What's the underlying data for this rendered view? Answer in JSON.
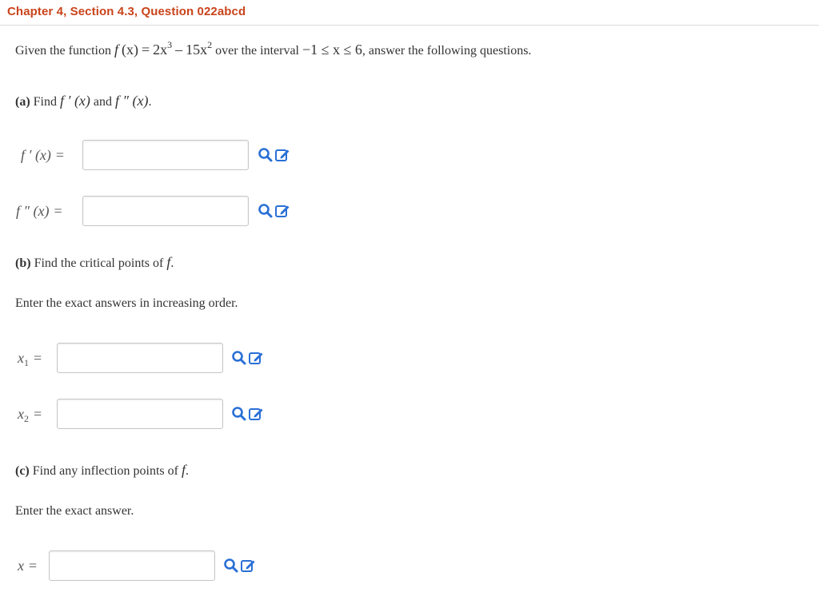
{
  "header": {
    "title": "Chapter 4, Section 4.3, Question 022abcd"
  },
  "problem": {
    "intro_prefix": "Given the function",
    "function_expr_f": "f",
    "function_expr_x": "(x)",
    "function_expr_eq": "=",
    "function_rhs_a": "2x",
    "function_rhs_a_exp": "3",
    "function_rhs_minus": "–",
    "function_rhs_b": "15x",
    "function_rhs_b_exp": "2",
    "interval_prefix": "over the interval",
    "interval_expr": "−1 ≤ x ≤ 6",
    "intro_suffix": ", answer the following questions."
  },
  "part_a": {
    "tag": "(a)",
    "text_find": "Find",
    "text_fp": "f ′ (x)",
    "text_and": "and",
    "text_fpp": "f ″ (x)",
    "text_end": ".",
    "rows": [
      {
        "label_fn": "f ′ (x)",
        "label_eq": "=",
        "value": "",
        "placeholder": ""
      },
      {
        "label_fn": "f ″ (x)",
        "label_eq": "=",
        "value": "",
        "placeholder": ""
      }
    ]
  },
  "part_b": {
    "tag": "(b)",
    "text": "Find the critical points of",
    "text_f": "f",
    "text_end": ".",
    "instruction": "Enter the exact answers in increasing order.",
    "rows": [
      {
        "label_var": "x",
        "label_sub": "1",
        "label_eq": "=",
        "value": "",
        "placeholder": ""
      },
      {
        "label_var": "x",
        "label_sub": "2",
        "label_eq": "=",
        "value": "",
        "placeholder": ""
      }
    ]
  },
  "part_c": {
    "tag": "(c)",
    "text": "Find any inflection points of",
    "text_f": "f",
    "text_end": ".",
    "instruction": "Enter the exact answer.",
    "rows": [
      {
        "label_var": "x",
        "label_eq": "=",
        "value": "",
        "placeholder": ""
      }
    ]
  },
  "icons": {
    "preview": "magnifier-icon",
    "edit": "edit-pencil-icon"
  },
  "colors": {
    "header": "#c9441a",
    "icon": "#2a6fd6",
    "text": "#333333"
  }
}
